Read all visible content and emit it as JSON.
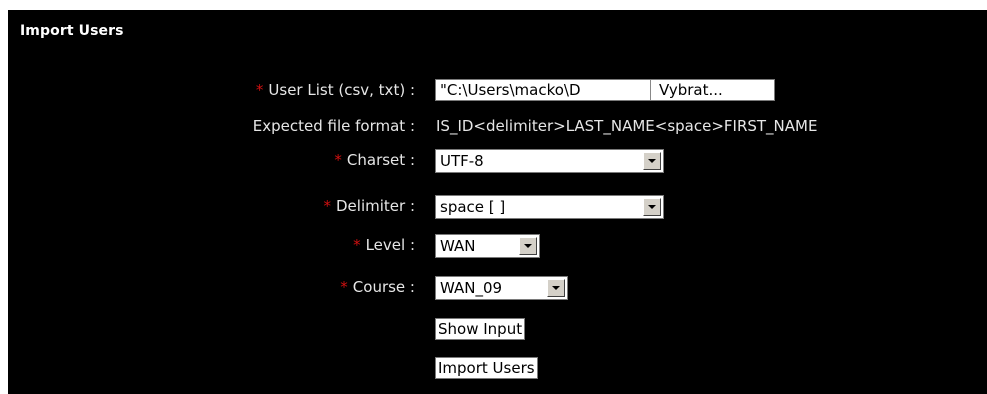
{
  "panel": {
    "title": "Import Users"
  },
  "form": {
    "required_marker": "*",
    "user_list": {
      "label": "User List (csv, txt) :",
      "path_value": "\"C:\\Users\\macko\\D",
      "browse_label": "Vybrat..."
    },
    "expected_format": {
      "label": "Expected file format :",
      "value": "IS_ID<delimiter>LAST_NAME<space>FIRST_NAME"
    },
    "charset": {
      "label": "Charset :",
      "selected": "UTF-8"
    },
    "delimiter": {
      "label": "Delimiter :",
      "selected": "space [ ]"
    },
    "level": {
      "label": "Level :",
      "selected": "WAN"
    },
    "course": {
      "label": "Course :",
      "selected": "WAN_09"
    },
    "show_input_label": "Show Input",
    "import_users_label": "Import Users"
  },
  "colors": {
    "panel_bg": "#000000",
    "label_text": "#e6e6e6",
    "required": "#d01010"
  },
  "icons": {
    "select_arrow": "chevron-down-icon"
  }
}
